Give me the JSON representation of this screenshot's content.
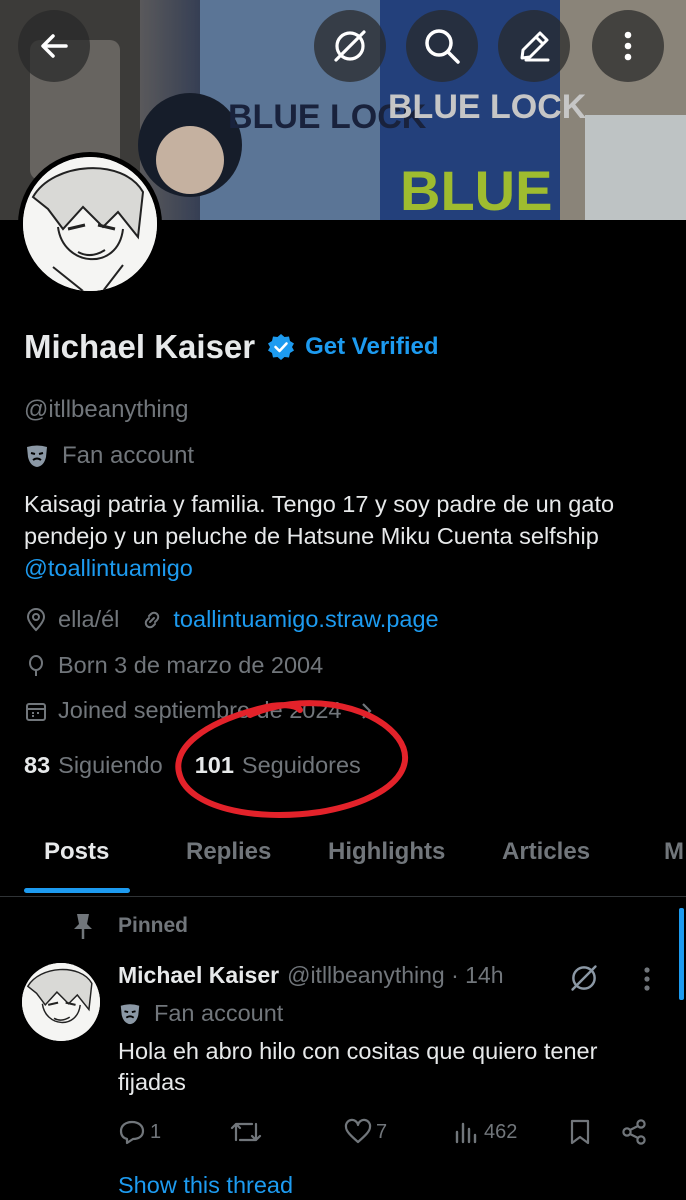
{
  "header": {
    "back_label": "←",
    "icons": [
      "back-arrow-icon",
      "grok-icon",
      "search-icon",
      "edit-icon",
      "more-vertical-icon"
    ]
  },
  "banner": {
    "text_left": "BLUE LOCK",
    "text_right": "BLUE LOCK",
    "text_big": "BLUE"
  },
  "profile": {
    "name": "Michael Kaiser",
    "get_verified": "Get Verified",
    "handle": "@itllbeanything",
    "label": "Fan account",
    "bio_text": "Kaisagi patria y familia. Tengo 17 y soy padre de un gato pendejo y un peluche de Hatsune Miku Cuenta selfship",
    "bio_mention": "@toallintuamigo",
    "location": "ella/él",
    "website": "toallintuamigo.straw.page",
    "born": "Born 3 de marzo de 2004",
    "joined": "Joined septiembre de 2024",
    "following_count": "83",
    "following_label": "Siguiendo",
    "followers_count": "101",
    "followers_label": "Seguidores"
  },
  "tabs": [
    {
      "label": "Posts",
      "active": true
    },
    {
      "label": "Replies"
    },
    {
      "label": "Highlights"
    },
    {
      "label": "Articles"
    },
    {
      "label": "M"
    }
  ],
  "pinned_post": {
    "pinned_label": "Pinned",
    "author": "Michael Kaiser",
    "handle_time": "@itllbeanything · 14h",
    "label": "Fan account",
    "text": "Hola eh abro hilo con cositas que quiero tener fijadas",
    "replies": "1",
    "retweets": "",
    "likes": "7",
    "views": "462",
    "show_thread": "Show this thread"
  },
  "colors": {
    "accent": "#1d9bf0",
    "annotation": "#e3222a",
    "muted": "#71767b"
  }
}
